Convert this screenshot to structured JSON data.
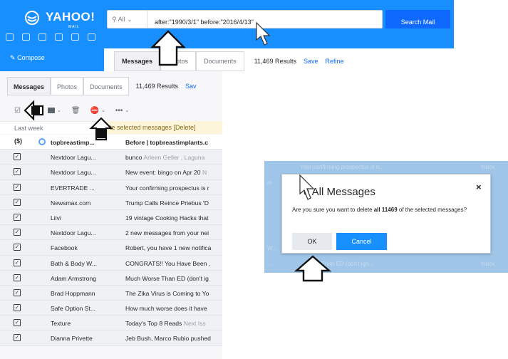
{
  "header": {
    "logo_name": "YAHOO!",
    "logo_sub": "MAIL",
    "search_scope": "All",
    "search_query": "after:\"1990/3/1\" before:\"2016/4/13\"",
    "search_button": "Search Mail",
    "compose_label": "Compose"
  },
  "tabs_top": {
    "messages": "Messages",
    "photos": "Photos",
    "documents": "Documents",
    "results": "11,469 Results",
    "save": "Save",
    "refine": "Refine"
  },
  "tabs_list": {
    "messages": "Messages",
    "photos": "Photos",
    "documents": "Documents",
    "results": "11,469 Results",
    "save": "Sav"
  },
  "list": {
    "section": "Last week",
    "banner": "te selected messages [Delete]",
    "rows": [
      {
        "sender": "topbreastimp...",
        "subject": "Before | topbreastimplants.c",
        "preview": ""
      },
      {
        "sender": "Nextdoor Lagu...",
        "subject": "bunco",
        "preview": "Arleen Geller , Laguna"
      },
      {
        "sender": "Nextdoor Lagu...",
        "subject": "New event: bingo on Apr 20",
        "preview": "N"
      },
      {
        "sender": "EVERTRADE ...",
        "subject": "Your confirming prospectus is r",
        "preview": ""
      },
      {
        "sender": "Newsmax.com",
        "subject": "Trump Calls Reince Priebus 'D",
        "preview": ""
      },
      {
        "sender": "Liivi",
        "subject": "19 vintage Cooking Hacks that",
        "preview": ""
      },
      {
        "sender": "Nextdoor Lagu...",
        "subject": "2 new messages from your nei",
        "preview": ""
      },
      {
        "sender": "Facebook",
        "subject": "Robert, you have 1 new notifica",
        "preview": ""
      },
      {
        "sender": "Bath & Body W...",
        "subject": "CONGRATS!! You Have Been ,",
        "preview": ""
      },
      {
        "sender": "Adam Armstrong",
        "subject": "Much Worse Than ED (don't ig",
        "preview": ""
      },
      {
        "sender": "Brad Hoppmann",
        "subject": "The Zika Virus is Coming to Yo",
        "preview": ""
      },
      {
        "sender": "Safe Option St...",
        "subject": "How much worse does it have",
        "preview": ""
      },
      {
        "sender": "Texture",
        "subject": "Today's Top 8 Reads",
        "preview": "Next Iss"
      },
      {
        "sender": "Dianna Privette",
        "subject": "Jeb Bush, Marco Rubio pushed",
        "preview": ""
      }
    ]
  },
  "dialog_bg": [
    {
      "left": "",
      "mid": "Your confirming prospectus is n...",
      "right": "Inbox"
    },
    {
      "left": "m",
      "mid": "",
      "right": ""
    },
    {
      "left": "W...",
      "mid": "",
      "right": ""
    },
    {
      "left": "...",
      "mid": "Than ED (don't ign...",
      "right": "Inbox"
    }
  ],
  "dialog": {
    "title": "e All Messages",
    "close": "×",
    "message_pre": "Are you sure you want to delete ",
    "message_bold": "all 11469",
    "message_post": " of the selected messages?",
    "ok": "OK",
    "cancel": "Cancel"
  },
  "colors": {
    "brand": "#188fff",
    "primary_button": "#0f69ff",
    "dialog_backdrop": "#9fc5e8"
  }
}
